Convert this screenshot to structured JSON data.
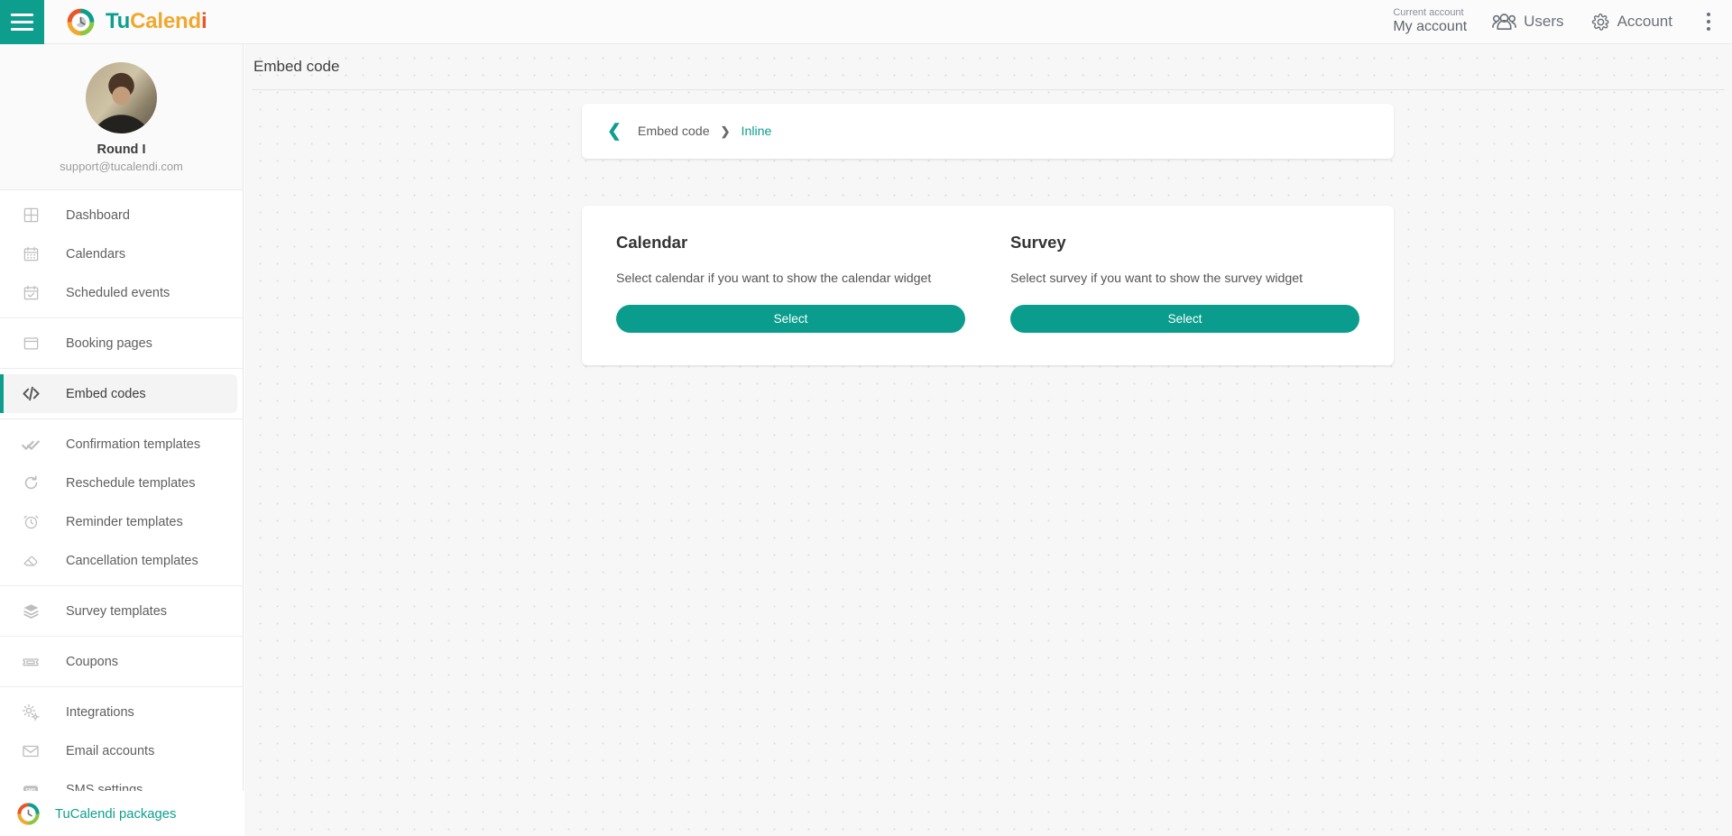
{
  "brand": {
    "part1": "Tu",
    "part2": "Calend",
    "part3": "i",
    "logo_icon": "tucalendi-clock-logo"
  },
  "topbar": {
    "menu_icon": "hamburger-menu-icon",
    "current_account_label": "Current account",
    "current_account_value": "My account",
    "users_label": "Users",
    "users_icon": "users-icon",
    "account_label": "Account",
    "account_icon": "gear-icon",
    "more_icon": "kebab-menu-icon"
  },
  "profile": {
    "name": "Round I",
    "email": "support@tucalendi.com",
    "avatar_icon": "user-avatar"
  },
  "sidebar": {
    "groups": [
      {
        "items": [
          {
            "label": "Dashboard",
            "icon": "dashboard-grid-icon",
            "active": false
          },
          {
            "label": "Calendars",
            "icon": "calendar-icon",
            "active": false
          },
          {
            "label": "Scheduled events",
            "icon": "calendar-check-icon",
            "active": false
          }
        ]
      },
      {
        "items": [
          {
            "label": "Booking pages",
            "icon": "browser-window-icon",
            "active": false
          }
        ]
      },
      {
        "items": [
          {
            "label": "Embed codes",
            "icon": "code-brackets-icon",
            "active": true
          }
        ]
      },
      {
        "items": [
          {
            "label": "Confirmation templates",
            "icon": "double-check-icon",
            "active": false
          },
          {
            "label": "Reschedule templates",
            "icon": "refresh-arrow-icon",
            "active": false
          },
          {
            "label": "Reminder templates",
            "icon": "alarm-clock-icon",
            "active": false
          },
          {
            "label": "Cancellation templates",
            "icon": "eraser-icon",
            "active": false
          }
        ]
      },
      {
        "items": [
          {
            "label": "Survey templates",
            "icon": "layers-icon",
            "active": false
          }
        ]
      },
      {
        "items": [
          {
            "label": "Coupons",
            "icon": "ticket-icon",
            "active": false
          }
        ]
      },
      {
        "items": [
          {
            "label": "Integrations",
            "icon": "gears-icon",
            "active": false
          },
          {
            "label": "Email accounts",
            "icon": "envelope-icon",
            "active": false
          },
          {
            "label": "SMS settings",
            "icon": "sms-icon",
            "active": false
          }
        ]
      }
    ],
    "footer": {
      "label": "TuCalendi packages",
      "icon": "tucalendi-clock-logo"
    }
  },
  "main": {
    "page_title": "Embed code",
    "breadcrumb": {
      "back_icon": "chevron-left-icon",
      "parent": "Embed code",
      "separator_icon": "chevron-right-icon",
      "current": "Inline"
    },
    "options": [
      {
        "title": "Calendar",
        "description": "Select calendar if you want to show the calendar widget",
        "button_label": "Select"
      },
      {
        "title": "Survey",
        "description": "Select survey if you want to show the survey widget",
        "button_label": "Select"
      }
    ]
  },
  "colors": {
    "accent": "#0d9e8e",
    "brand_orange": "#e8562a",
    "brand_amber": "#f0a82e",
    "brand_green": "#8cc63f",
    "page_background": "#f7f7f7",
    "card_background": "#ffffff"
  }
}
